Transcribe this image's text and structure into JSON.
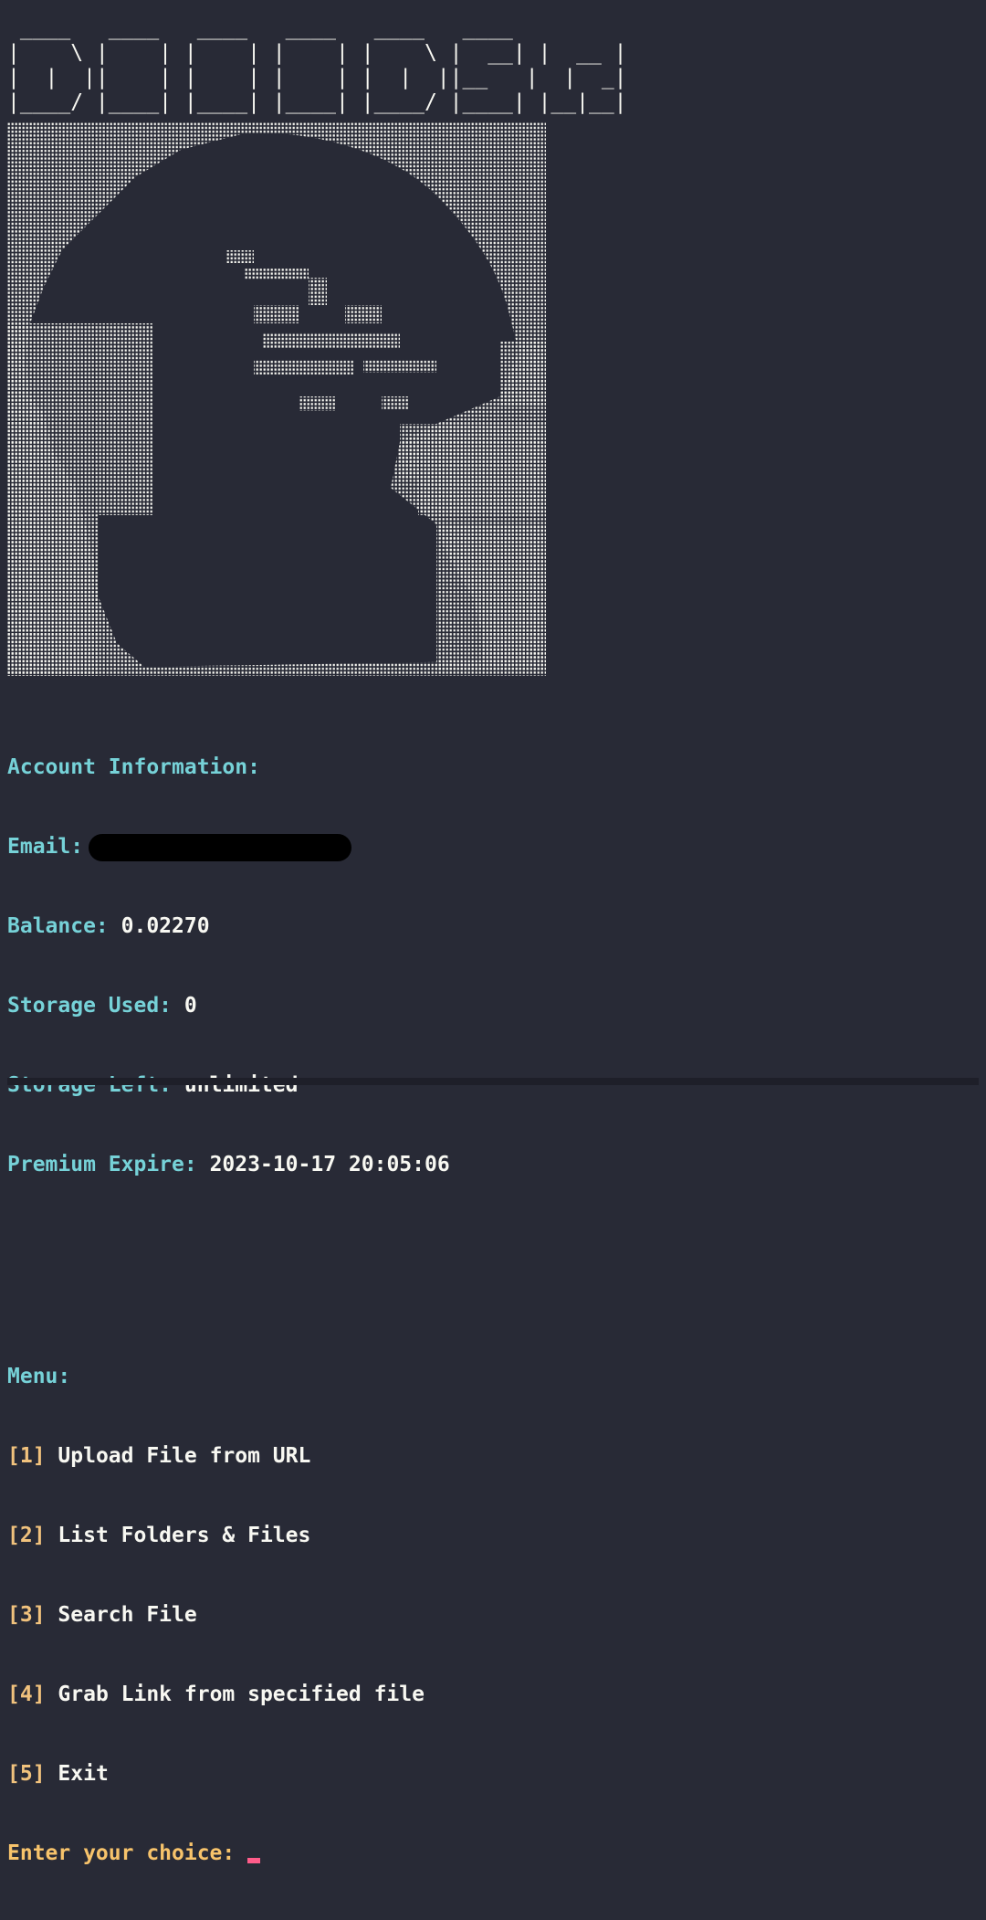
{
  "logo": {
    "ascii": " ____   ____   ____   ____   ____   ____ \n|    \\ |    | |    | |    | |    \\ |  __| |  __ |\n|  |  ||    | |    | |    | |  |  ||__   |  |  _|\n|____/ |____| |____| |____| |____/ |____| |__|__|"
  },
  "art": {
    "description_icon": "braille-portrait-art"
  },
  "account": {
    "heading": "Account Information:",
    "email_label": "Email:",
    "balance_label": "Balance:",
    "balance_value": "0.02270",
    "storage_used_label": "Storage Used:",
    "storage_used_value": "0",
    "storage_left_label": "Storage Left:",
    "storage_left_value": "unlimited",
    "premium_label": "Premium Expire:",
    "premium_value": "2023-10-17 20:05:06"
  },
  "menu": {
    "heading": "Menu:",
    "items": [
      {
        "key": "[1]",
        "label": "Upload File from URL"
      },
      {
        "key": "[2]",
        "label": "List Folders & Files"
      },
      {
        "key": "[3]",
        "label": "Search File"
      },
      {
        "key": "[4]",
        "label": "Grab Link from specified file"
      },
      {
        "key": "[5]",
        "label": "Exit"
      }
    ]
  },
  "prompt": {
    "text": "Enter your choice:"
  },
  "colors": {
    "background": "#282a36",
    "label": "#5fdcb5",
    "bracket": "#f1c27d",
    "cursor": "#ff5c8a"
  }
}
